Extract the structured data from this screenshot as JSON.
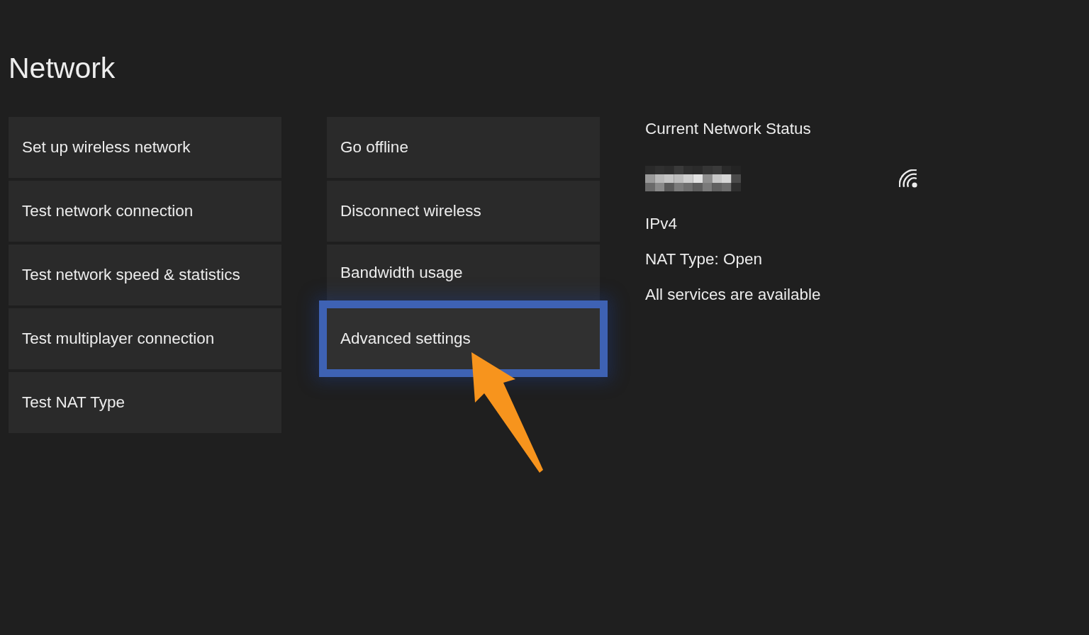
{
  "page": {
    "title": "Network"
  },
  "menu_columns": [
    {
      "items": [
        {
          "label": "Set up wireless network",
          "selected": false
        },
        {
          "label": "Test network connection",
          "selected": false
        },
        {
          "label": "Test network speed & statistics",
          "selected": false
        },
        {
          "label": "Test multiplayer connection",
          "selected": false
        },
        {
          "label": "Test NAT Type",
          "selected": false
        }
      ]
    },
    {
      "items": [
        {
          "label": "Go offline",
          "selected": false
        },
        {
          "label": "Disconnect wireless",
          "selected": false
        },
        {
          "label": "Bandwidth usage",
          "selected": false
        },
        {
          "label": "Advanced settings",
          "selected": true
        }
      ]
    }
  ],
  "status_panel": {
    "heading": "Current Network Status",
    "lines": [
      "IPv4",
      "NAT Type: Open",
      "All services are available"
    ]
  }
}
